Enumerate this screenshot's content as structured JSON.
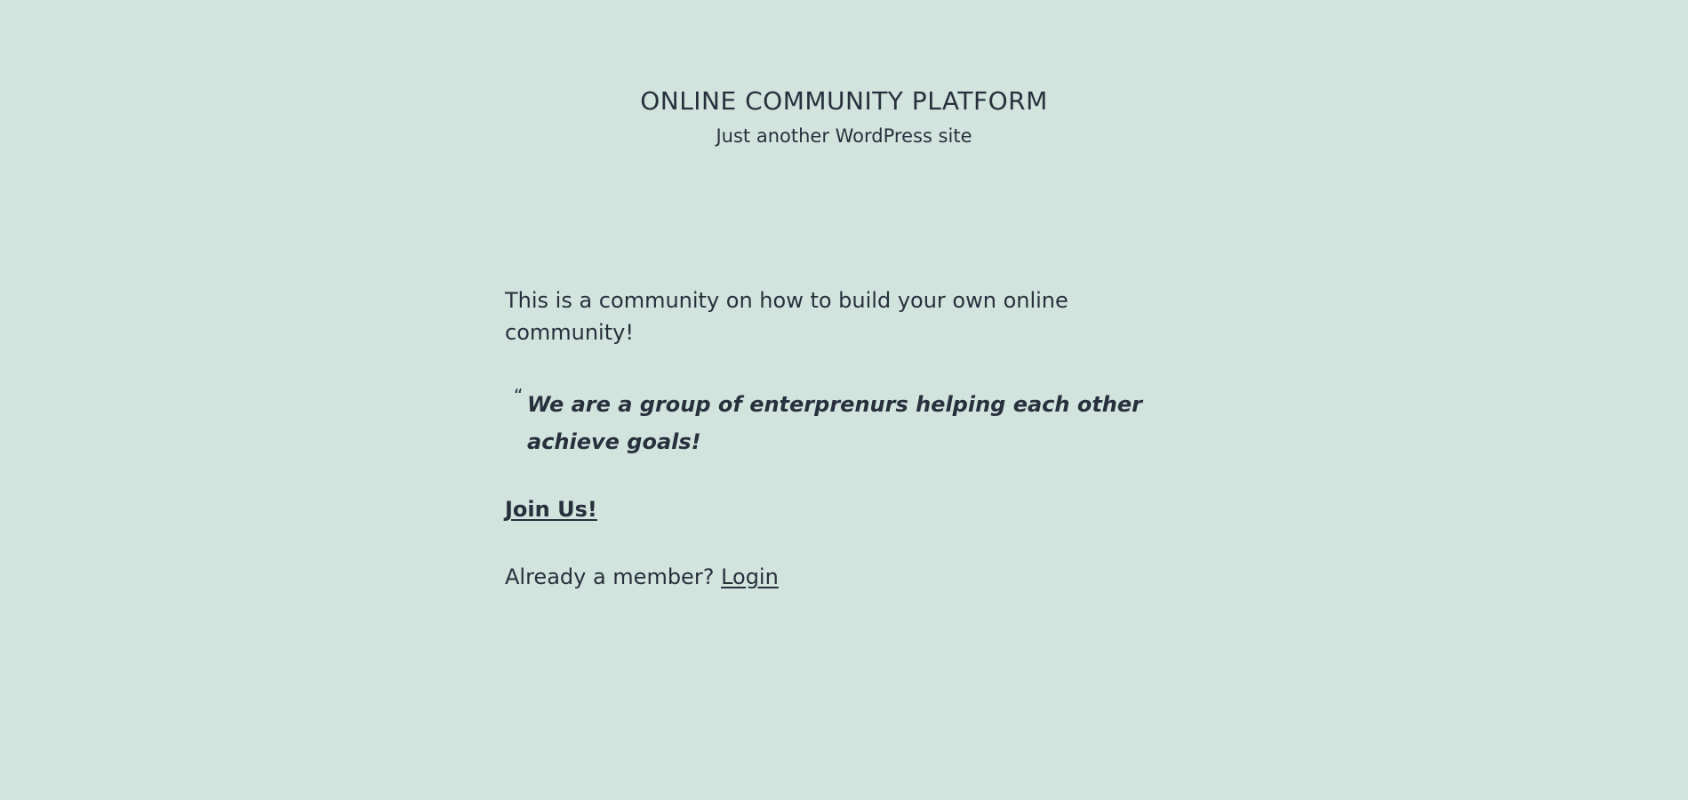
{
  "header": {
    "site_title": "ONLINE COMMUNITY PLATFORM",
    "site_description": "Just another WordPress site"
  },
  "content": {
    "intro": "This is a community on how to build your own online community!",
    "quote_mark": "“",
    "quote_text": "We are a group of enterprenurs helping each other achieve goals!",
    "join_label": "Join Us!",
    "member_text": "Already a member? ",
    "login_label": "Login"
  },
  "colors": {
    "background": "#d1e4dd",
    "text": "#28303d"
  }
}
